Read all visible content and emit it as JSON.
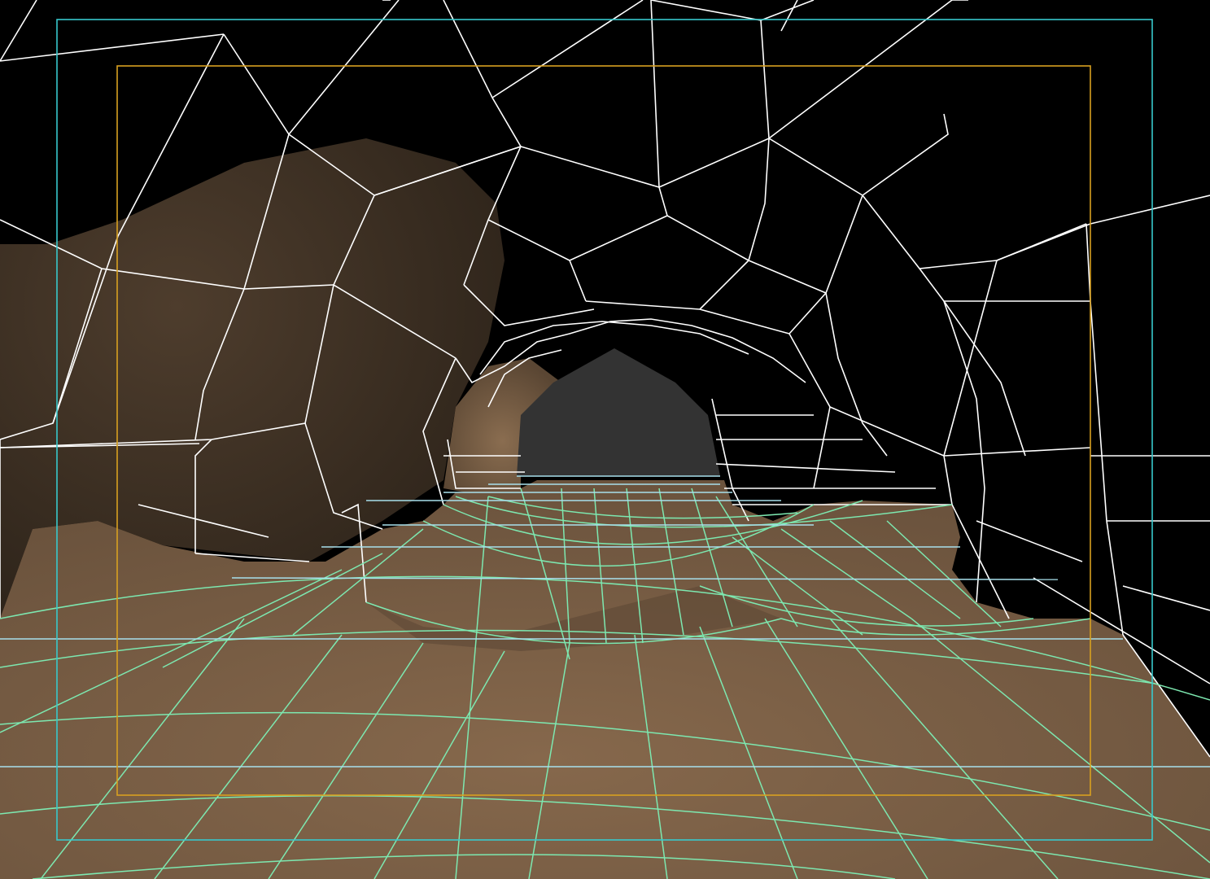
{
  "viewport": {
    "background": "#000000",
    "shading": {
      "floor_light": "#86684c",
      "floor_dark": "#6b533d",
      "left_wall": "#4a3a2b",
      "tunnel_end": "#333333"
    },
    "wire_colors": {
      "mesh": "#ffffff",
      "floor_mesh": "#7de8b0",
      "tunnel_floor": "#a8e0ec"
    },
    "guides": {
      "safe_action_color": "#38c8cc",
      "safe_title_color": "#d8a020"
    }
  }
}
